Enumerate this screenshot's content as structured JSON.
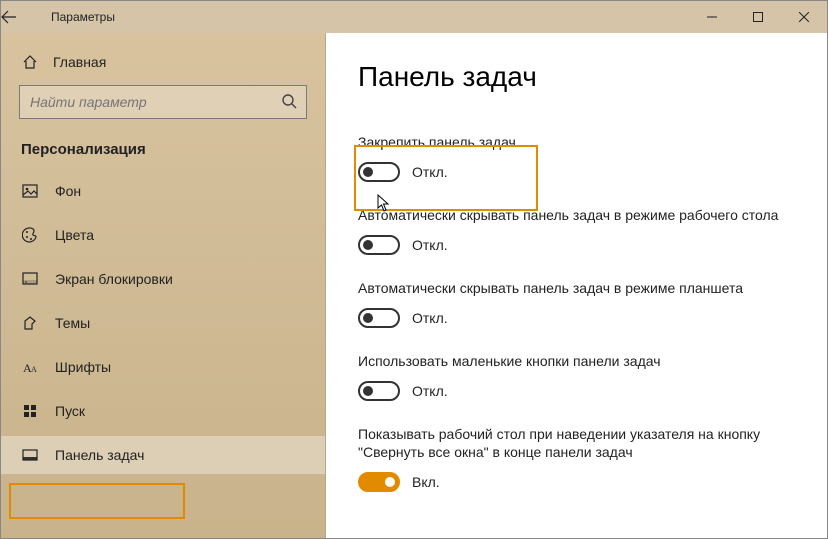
{
  "window": {
    "title": "Параметры"
  },
  "sidebar": {
    "home": "Главная",
    "search_placeholder": "Найти параметр",
    "section": "Персонализация",
    "items": [
      {
        "label": "Фон"
      },
      {
        "label": "Цвета"
      },
      {
        "label": "Экран блокировки"
      },
      {
        "label": "Темы"
      },
      {
        "label": "Шрифты"
      },
      {
        "label": "Пуск"
      },
      {
        "label": "Панель задач"
      }
    ]
  },
  "content": {
    "title": "Панель задач",
    "settings": [
      {
        "label": "Закрепить панель задач",
        "state": "Откл.",
        "on": false
      },
      {
        "label": "Автоматически скрывать панель задач в режиме рабочего стола",
        "state": "Откл.",
        "on": false
      },
      {
        "label": "Автоматически скрывать панель задач в режиме планшета",
        "state": "Откл.",
        "on": false
      },
      {
        "label": "Использовать маленькие кнопки панели задач",
        "state": "Откл.",
        "on": false
      },
      {
        "label": "Показывать рабочий стол при наведении указателя на кнопку \"Свернуть все окна\" в конце панели задач",
        "state": "Вкл.",
        "on": true
      }
    ]
  }
}
